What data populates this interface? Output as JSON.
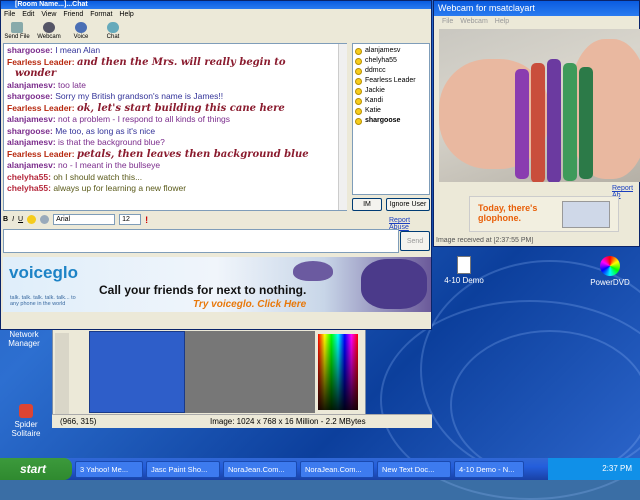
{
  "chat": {
    "title": "[Room Name...]...Chat",
    "menu": [
      "File",
      "Edit",
      "View",
      "Friend",
      "Format",
      "Help"
    ],
    "toolbar": [
      "Send File",
      "Webcam",
      "Voice",
      "Chat"
    ],
    "messages": [
      {
        "nick": "shargoose:",
        "text": "I mean Alan",
        "style": "plain",
        "nickColor": "#7b2c8c",
        "textColor": "#333399"
      },
      {
        "nick": "Fearless Leader:",
        "text": "and then the Mrs. will really begin to",
        "style": "fancy",
        "nickColor": "#b7280e"
      },
      {
        "nick": "",
        "text": "wonder",
        "style": "fancy",
        "nickColor": "#b7280e"
      },
      {
        "nick": "alanjamesv:",
        "text": "too late",
        "style": "plain",
        "nickColor": "#7b2c8c",
        "textColor": "#7b2c8c"
      },
      {
        "nick": "shargoose:",
        "text": "Sorry my British grandson's name is James!!",
        "style": "plain",
        "nickColor": "#7b2c8c",
        "textColor": "#333399"
      },
      {
        "nick": "Fearless Leader:",
        "text": "ok, let's start building this cane here",
        "style": "fancy",
        "nickColor": "#b7280e"
      },
      {
        "nick": "alanjamesv:",
        "text": "not a problem - I respond to all kinds of things",
        "style": "plain",
        "nickColor": "#7b2c8c",
        "textColor": "#7b2c8c"
      },
      {
        "nick": "shargoose:",
        "text": "Me too, as long as it's nice",
        "style": "plain",
        "nickColor": "#7b2c8c",
        "textColor": "#333399"
      },
      {
        "nick": "alanjamesv:",
        "text": "is that the background blue?",
        "style": "plain",
        "nickColor": "#7b2c8c",
        "textColor": "#7b2c8c"
      },
      {
        "nick": "Fearless Leader:",
        "text": "petals, then leaves then background blue",
        "style": "fancy",
        "nickColor": "#b7280e"
      },
      {
        "nick": "alanjamesv:",
        "text": "no - I meant in the bullseye",
        "style": "plain",
        "nickColor": "#7b2c8c",
        "textColor": "#7b2c8c"
      },
      {
        "nick": "chelyha55:",
        "text": "oh I should watch this...",
        "style": "plain",
        "nickColor": "#b5283c",
        "textColor": "#5a5a1a"
      },
      {
        "nick": "chelyha55:",
        "text": "always up for learning a new flower",
        "style": "plain",
        "nickColor": "#b5283c",
        "textColor": "#5a5a1a"
      }
    ],
    "users": [
      "alanjamesv",
      "chelyha55",
      "ddmcc",
      "Fearless Leader",
      "Jackie",
      "Kandi",
      "Katie",
      "shargoose"
    ],
    "im_button": "IM",
    "ignore_button": "Ignore User",
    "report_link": "Report Abuse",
    "format": {
      "bold": "B",
      "italic": "I",
      "underline": "U",
      "font": "Arial",
      "size": "12"
    },
    "send_button": "Send",
    "ad": {
      "logo": "voiceglo",
      "tagline": "talk. talk. talk. talk. talk... to any phone in the world",
      "headline": "Call your friends for next to nothing.",
      "cta": "Try voiceglo. Click Here"
    }
  },
  "webcam": {
    "title": "Webcam for msatclayart",
    "menu": [
      "File",
      "Webcam",
      "Help"
    ],
    "report_link": "Report Ab",
    "ad_text": "Today, there's glophone.",
    "status": "Image received at [2:37:55 PM]"
  },
  "paint": {
    "status_coords": "(966, 315)",
    "status_image": "Image:  1024 x 768 x 16 Million - 2.2 MBytes"
  },
  "desktop_icons": [
    {
      "label": "4-10 Demo"
    },
    {
      "label": "PowerDVD"
    },
    {
      "label": "Network Manager"
    },
    {
      "label": "Spider Solitaire"
    }
  ],
  "taskbar": {
    "start": "start",
    "tasks": [
      "3 Yahoo! Me...",
      "Jasc Paint Sho...",
      "NoraJean.Com...",
      "NoraJean.Com...",
      "New Text Doc...",
      "4-10 Demo - N..."
    ],
    "clock": "2:37 PM"
  }
}
